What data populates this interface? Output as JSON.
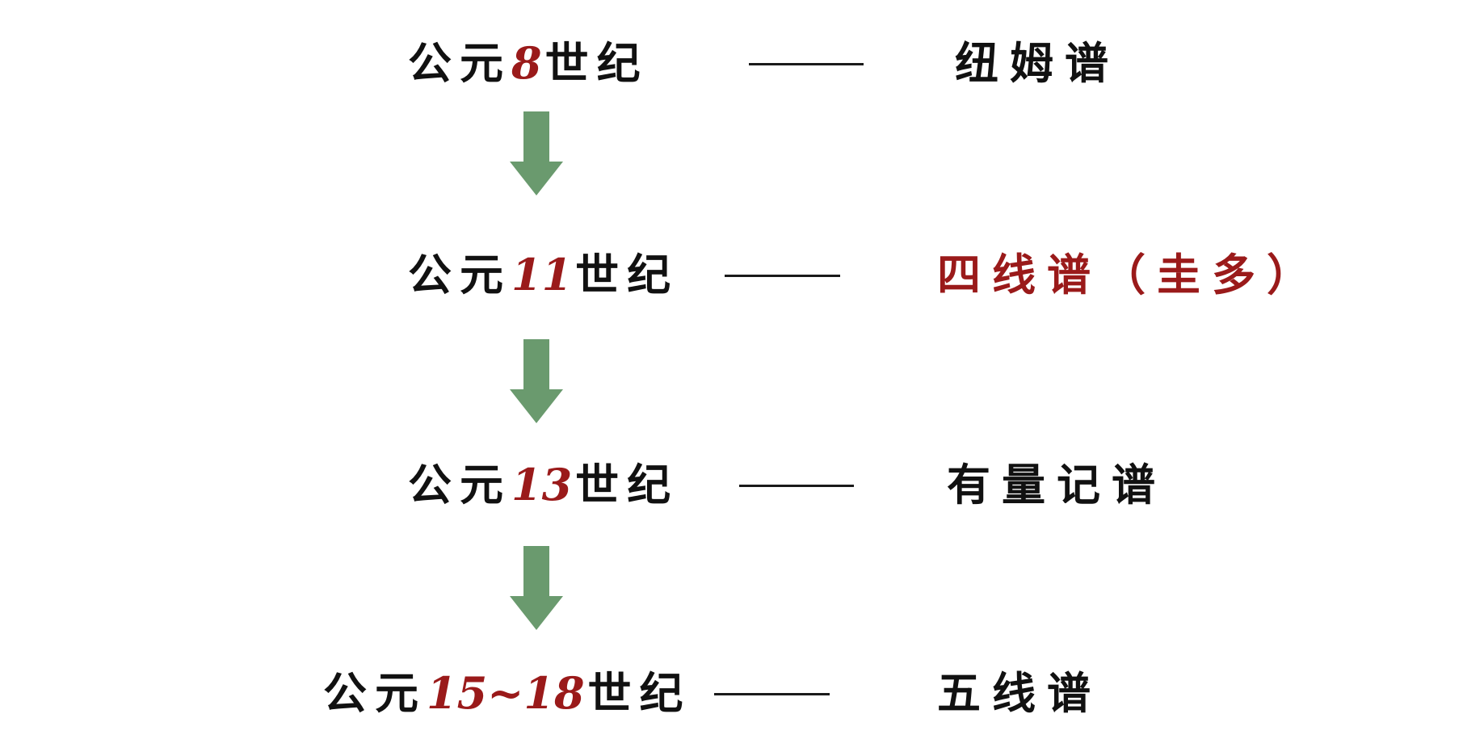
{
  "rows": [
    {
      "prefix": "公元",
      "number": "8",
      "suffix": "世纪",
      "notation": "纽姆谱"
    },
    {
      "prefix": "公元",
      "number": "11",
      "suffix": "世纪",
      "notation": "四线谱（圭多）"
    },
    {
      "prefix": "公元",
      "number": "13",
      "suffix": "世纪",
      "notation": "有量记谱"
    },
    {
      "prefix": "公元",
      "number": "15~18",
      "suffix": "世纪",
      "notation": "五线谱"
    }
  ],
  "colors": {
    "text": "#111111",
    "accent": "#9a1a1a",
    "arrow": "#6a9a6e"
  },
  "icons": {
    "arrow": "down-arrow-icon"
  }
}
